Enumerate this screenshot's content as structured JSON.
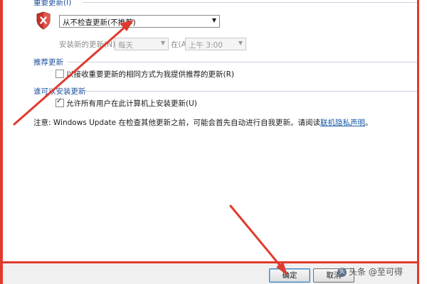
{
  "important_updates": {
    "title": "重要更新(I)",
    "shield_icon": "shield-error-icon",
    "selected_option": "从不检查更新(不推荐)",
    "install_label": "安装新的更新(N):",
    "day_value": "每天",
    "at_label": "在(A)",
    "time_value": "上午 3:00"
  },
  "recommended_updates": {
    "title": "推荐更新",
    "checkbox_label": "以接收重要更新的相同方式为我提供推荐的更新(R)",
    "checked": false
  },
  "who_can_install": {
    "title": "谁可以安装更新",
    "checkbox_label": "允许所有用户在此计算机上安装更新(U)",
    "checked": true
  },
  "note": {
    "text": "注意: Windows Update 在检查其他更新之前，可能会首先自动进行自我更新。请阅读",
    "link": "联机隐私声明",
    "end": "。"
  },
  "buttons": {
    "ok": "确定",
    "cancel": "取消"
  },
  "watermark": {
    "icon_text": "头",
    "text": "头条 @至可得"
  },
  "colors": {
    "annotation_red": "#e03a2e",
    "section_title_blue": "#1d4f9c"
  }
}
